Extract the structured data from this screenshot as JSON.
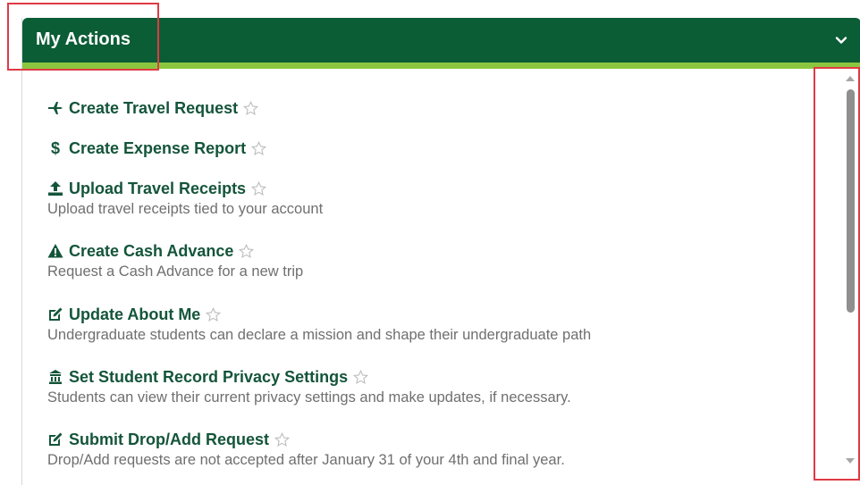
{
  "header": {
    "title": "My Actions"
  },
  "colors": {
    "header_bg": "#0b5d36",
    "accent": "#8cc63f",
    "link": "#14553a",
    "callout": "#e03a44"
  },
  "actions": [
    {
      "icon": "airplane-icon",
      "title": "Create Travel Request",
      "description": ""
    },
    {
      "icon": "dollar-icon",
      "title": "Create Expense Report",
      "description": ""
    },
    {
      "icon": "upload-icon",
      "title": "Upload Travel Receipts",
      "description": "Upload travel receipts tied to your account"
    },
    {
      "icon": "warning-icon",
      "title": "Create Cash Advance",
      "description": "Request a Cash Advance for a new trip"
    },
    {
      "icon": "edit-icon",
      "title": "Update About Me",
      "description": "Undergraduate students can declare a mission and shape their undergraduate path"
    },
    {
      "icon": "building-icon",
      "title": "Set Student Record Privacy Settings",
      "description": "Students can view their current privacy settings and make updates, if necessary."
    },
    {
      "icon": "edit-icon",
      "title": "Submit Drop/Add Request",
      "description": "Drop/Add requests are not accepted after January 31 of your 4th and final year."
    }
  ]
}
